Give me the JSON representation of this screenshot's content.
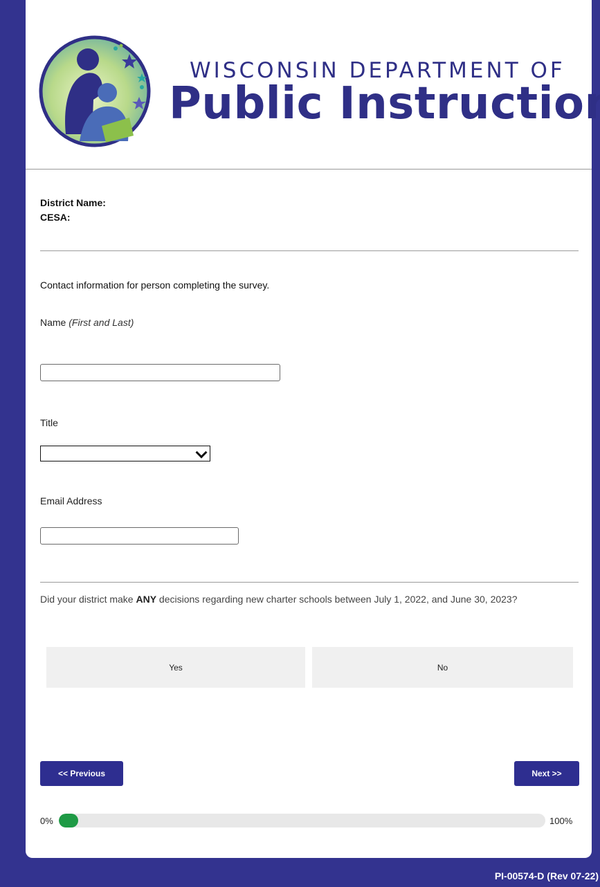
{
  "logo": {
    "line1": "WISCONSIN DEPARTMENT OF",
    "line2": "Public Instruction"
  },
  "meta": {
    "district_label": "District Name:",
    "cesa_label": "CESA:"
  },
  "contact": {
    "intro": "Contact information for person completing the survey.",
    "name_label": "Name",
    "name_hint": "(First and Last)",
    "name_value": "",
    "title_label": "Title",
    "title_selected": "",
    "email_label": "Email Address",
    "email_value": ""
  },
  "question": {
    "before": "Did your district make ",
    "emphasis": "ANY",
    "after": " decisions regarding new charter schools between July 1, 2022, and June 30, 2023?",
    "options": [
      "Yes",
      "No"
    ]
  },
  "nav": {
    "previous_label": "<< Previous",
    "next_label": "Next >>"
  },
  "progress": {
    "min_label": "0%",
    "max_label": "100%",
    "value": 0.04
  },
  "footer": {
    "form_code": "PI-00574-D (Rev 07-22)"
  },
  "colors": {
    "frame": "#33338f",
    "brand": "#2e2e90",
    "progress": "#1e9a45"
  }
}
